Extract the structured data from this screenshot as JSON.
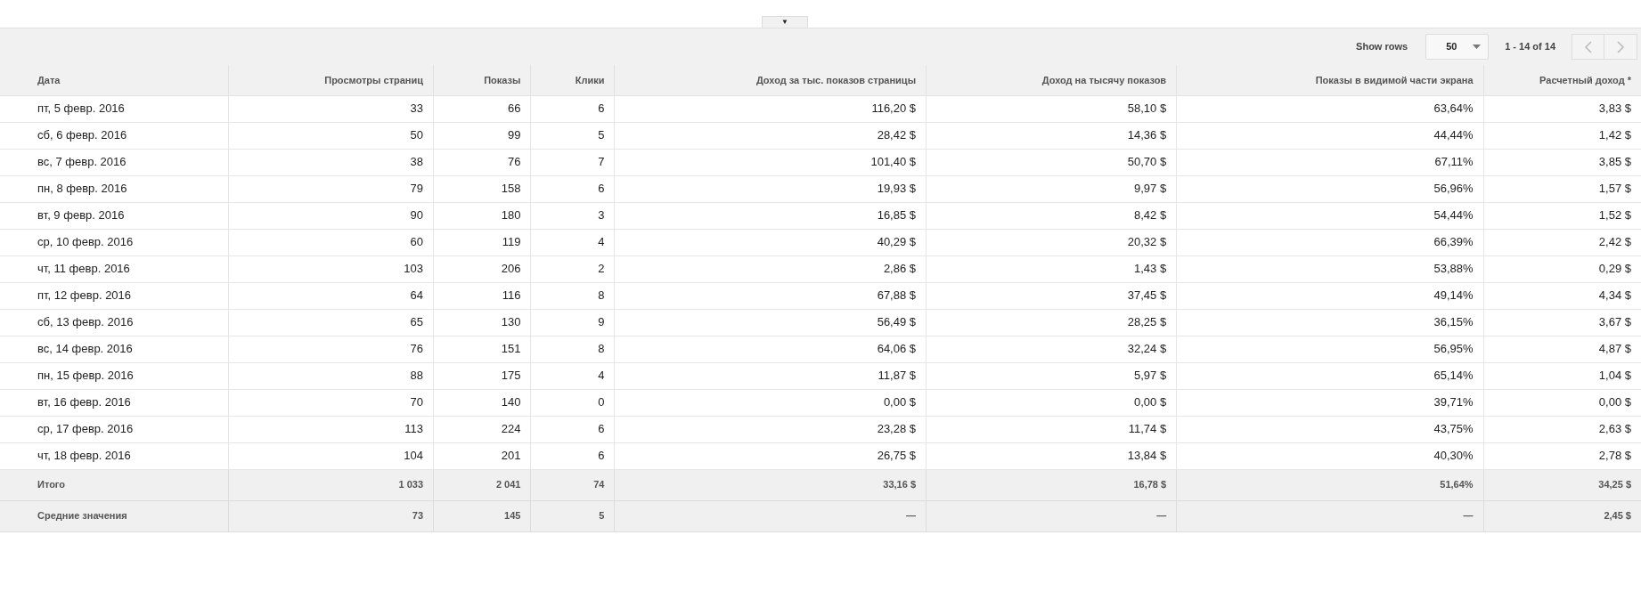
{
  "collapse_tab": {
    "icon": "▼"
  },
  "toolbar": {
    "show_rows_label": "Show rows",
    "rows_select": {
      "value": "50"
    },
    "range": "1 - 14 of 14",
    "prev": {
      "disabled": true
    },
    "next": {
      "disabled": true
    }
  },
  "table": {
    "columns": [
      "Дата",
      "Просмотры страниц",
      "Показы",
      "Клики",
      "Доход за тыс. показов страницы",
      "Доход на тысячу показов",
      "Показы в видимой части экрана",
      "Расчетный доход *"
    ],
    "rows": [
      [
        "пт, 5 февр. 2016",
        "33",
        "66",
        "6",
        "116,20 $",
        "58,10 $",
        "63,64%",
        "3,83 $"
      ],
      [
        "сб, 6 февр. 2016",
        "50",
        "99",
        "5",
        "28,42 $",
        "14,36 $",
        "44,44%",
        "1,42 $"
      ],
      [
        "вс, 7 февр. 2016",
        "38",
        "76",
        "7",
        "101,40 $",
        "50,70 $",
        "67,11%",
        "3,85 $"
      ],
      [
        "пн, 8 февр. 2016",
        "79",
        "158",
        "6",
        "19,93 $",
        "9,97 $",
        "56,96%",
        "1,57 $"
      ],
      [
        "вт, 9 февр. 2016",
        "90",
        "180",
        "3",
        "16,85 $",
        "8,42 $",
        "54,44%",
        "1,52 $"
      ],
      [
        "ср, 10 февр. 2016",
        "60",
        "119",
        "4",
        "40,29 $",
        "20,32 $",
        "66,39%",
        "2,42 $"
      ],
      [
        "чт, 11 февр. 2016",
        "103",
        "206",
        "2",
        "2,86 $",
        "1,43 $",
        "53,88%",
        "0,29 $"
      ],
      [
        "пт, 12 февр. 2016",
        "64",
        "116",
        "8",
        "67,88 $",
        "37,45 $",
        "49,14%",
        "4,34 $"
      ],
      [
        "сб, 13 февр. 2016",
        "65",
        "130",
        "9",
        "56,49 $",
        "28,25 $",
        "36,15%",
        "3,67 $"
      ],
      [
        "вс, 14 февр. 2016",
        "76",
        "151",
        "8",
        "64,06 $",
        "32,24 $",
        "56,95%",
        "4,87 $"
      ],
      [
        "пн, 15 февр. 2016",
        "88",
        "175",
        "4",
        "11,87 $",
        "5,97 $",
        "65,14%",
        "1,04 $"
      ],
      [
        "вт, 16 февр. 2016",
        "70",
        "140",
        "0",
        "0,00 $",
        "0,00 $",
        "39,71%",
        "0,00 $"
      ],
      [
        "ср, 17 февр. 2016",
        "113",
        "224",
        "6",
        "23,28 $",
        "11,74 $",
        "43,75%",
        "2,63 $"
      ],
      [
        "чт, 18 февр. 2016",
        "104",
        "201",
        "6",
        "26,75 $",
        "13,84 $",
        "40,30%",
        "2,78 $"
      ]
    ],
    "summary_rows": [
      [
        "Итого",
        "1 033",
        "2 041",
        "74",
        "33,16 $",
        "16,78 $",
        "51,64%",
        "34,25 $"
      ],
      [
        "Средние значения",
        "73",
        "145",
        "5",
        "—",
        "—",
        "—",
        "2,45 $"
      ]
    ]
  }
}
